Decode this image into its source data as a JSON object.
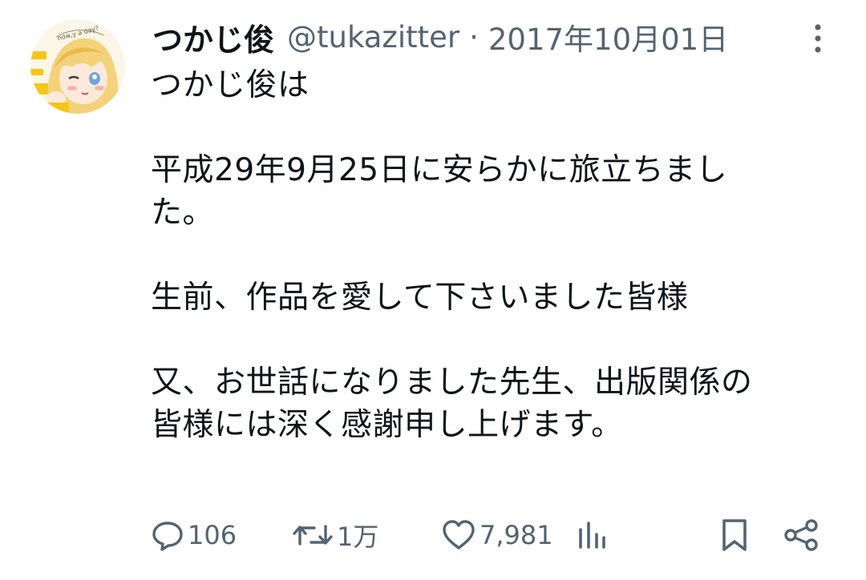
{
  "tweet": {
    "display_name": "つかじ俊",
    "handle": "@tukazitter",
    "separator": "·",
    "date": "2017年10月01日",
    "text": "つかじ俊は\n\n平成29年9月25日に安らかに旅立ちまし\nた。\n\n生前、作品を愛して下さいました皆様\n\n又、お世話になりました先生、出版関係の\n皆様には深く感謝申し上げます。",
    "avatar_badge_text": "now,y a day?"
  },
  "actions": {
    "reply_count": "106",
    "retweet_count": "1万",
    "like_count": "7,981"
  },
  "icons": {
    "more": "more-vertical-icon",
    "reply": "reply-icon",
    "retweet": "retweet-icon",
    "like": "heart-icon",
    "views": "views-icon",
    "bookmark": "bookmark-icon",
    "share": "share-icon"
  },
  "colors": {
    "text": "#0f1419",
    "secondary": "#536471",
    "avatar_yellow": "#f5c518"
  }
}
